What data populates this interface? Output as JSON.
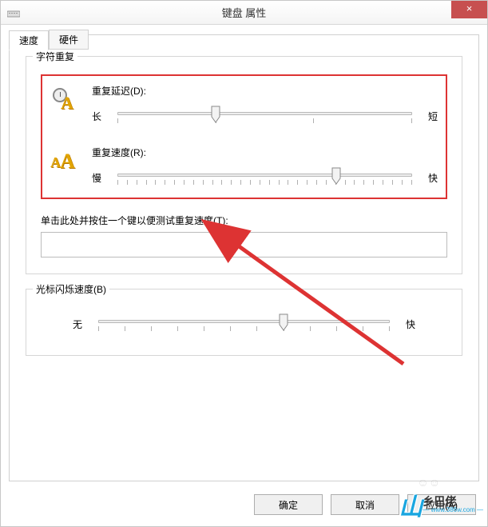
{
  "window": {
    "title": "键盘 属性",
    "close_symbol": "×"
  },
  "tabs": {
    "speed": "速度",
    "hardware": "硬件"
  },
  "char_repeat": {
    "group_title": "字符重复",
    "delay": {
      "label": "重复延迟(D):",
      "min_label": "长",
      "max_label": "短",
      "ticks": 4,
      "value_index": 1
    },
    "rate": {
      "label": "重复速度(R):",
      "min_label": "慢",
      "max_label": "快",
      "ticks": 32,
      "value_index": 23
    },
    "test_label": "单击此处并按住一个键以便测试重复速度(T):",
    "test_value": ""
  },
  "cursor_blink": {
    "group_title": "光标闪烁速度(B)",
    "min_label": "无",
    "max_label": "快",
    "ticks": 12,
    "value_index": 7
  },
  "buttons": {
    "ok": "确定",
    "cancel": "取消",
    "apply": "应用(A)"
  },
  "watermark": {
    "logo": "山",
    "text_a": "乡巴佬",
    "text_b": "— www.386w.com —"
  }
}
